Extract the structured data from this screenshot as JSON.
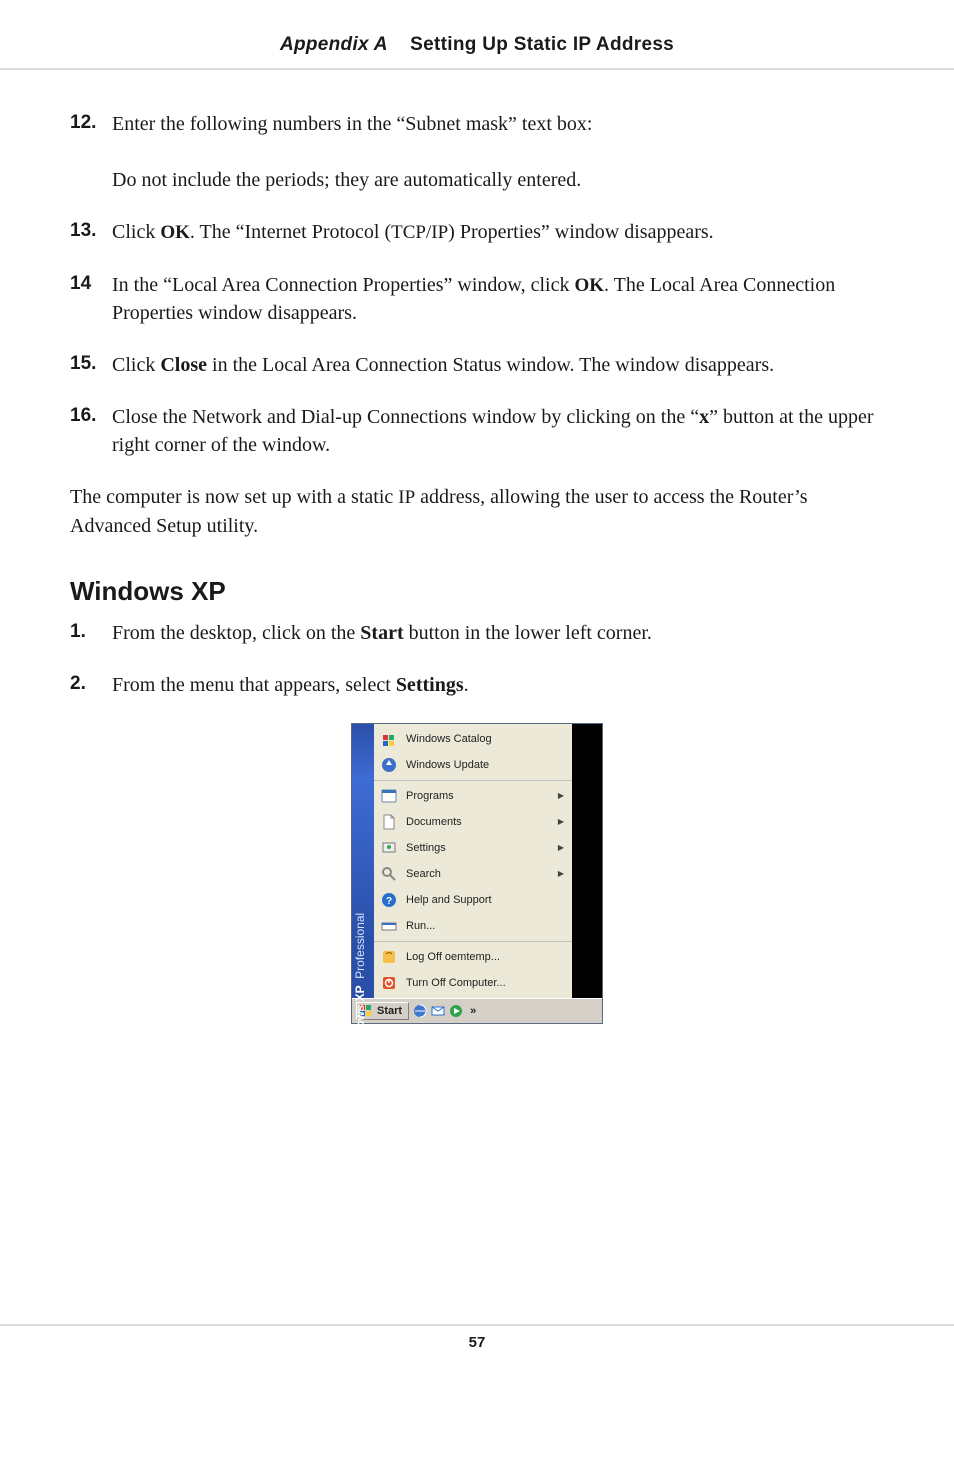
{
  "header": {
    "appendix": "Appendix A",
    "title": "Setting Up Static IP Address"
  },
  "steps": {
    "s12": {
      "num": "12.",
      "line1": "Enter the following numbers in the “Subnet mask” text box:",
      "line2": "Do not include the periods; they are automatically entered."
    },
    "s13": {
      "num": "13.",
      "pre": "Click ",
      "ok": "OK",
      "post1": ". The “Internet Protocol (",
      "tcpip": "TCP/IP",
      "post2": ") Properties” window disappears."
    },
    "s14": {
      "num": "14",
      "pre": "In the “Local Area Connection Properties” window, click ",
      "ok": "OK",
      "post": ". The Local Area Connection Properties window disappears."
    },
    "s15": {
      "num": "15.",
      "pre": "Click ",
      "close": "Close",
      "post": " in the Local Area Connection Status window. The window disappears."
    },
    "s16": {
      "num": "16.",
      "pre": "Close the Network and Dial-up Connections window by clicking on the “",
      "x": "x",
      "post": "” button at the upper right corner of the window."
    }
  },
  "aftertext": {
    "pre": "The computer is now set up with a static ",
    "ip": "IP",
    "post": " address, allowing the user to access the Router’s Advanced Setup utility."
  },
  "os_heading": "Windows XP",
  "xp_steps": {
    "s1": {
      "num": "1.",
      "pre": "From the desktop, click on the ",
      "start": "Start",
      "post": " button in the lower left corner."
    },
    "s2": {
      "num": "2.",
      "pre": "From the menu that appears, select ",
      "settings": "Settings",
      "post": "."
    }
  },
  "start_menu": {
    "side_brand": "Windows XP",
    "side_edition": "Professional",
    "items_top": [
      {
        "label": "Windows Catalog"
      },
      {
        "label": "Windows Update"
      }
    ],
    "items_mid": [
      {
        "label": "Programs",
        "arrow": true
      },
      {
        "label": "Documents",
        "arrow": true
      },
      {
        "label": "Settings",
        "arrow": true
      },
      {
        "label": "Search",
        "arrow": true
      },
      {
        "label": "Help and Support"
      },
      {
        "label": "Run..."
      }
    ],
    "items_bot": [
      {
        "label": "Log Off oemtemp..."
      },
      {
        "label": "Turn Off Computer..."
      }
    ],
    "taskbar": {
      "start": "Start",
      "more": "»"
    }
  },
  "page_number": "57"
}
